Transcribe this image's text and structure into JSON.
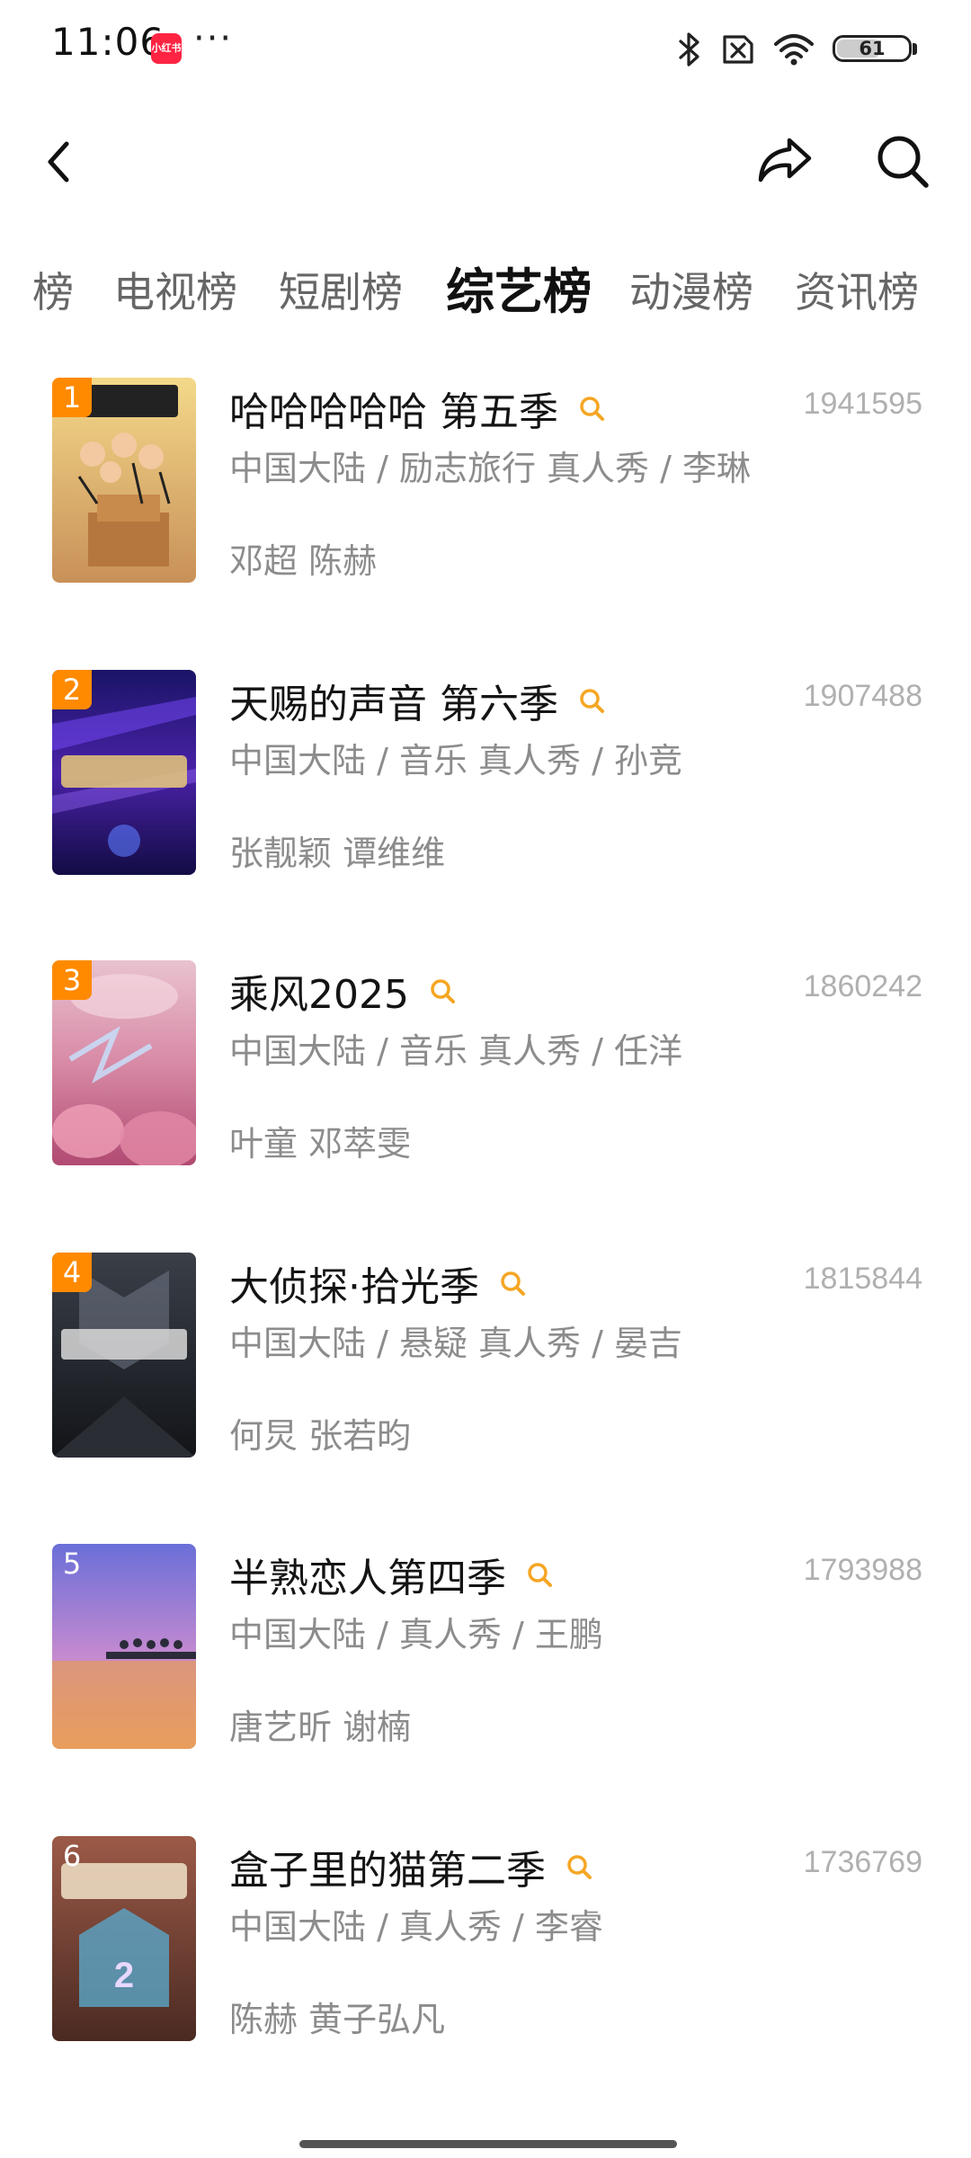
{
  "status": {
    "time": "11:06",
    "app_badge": "小红书",
    "more": "···",
    "battery": "61",
    "battery_level": 0.61
  },
  "nav": {
    "back_icon": "chevron-left-icon",
    "share_icon": "share-icon",
    "search_icon": "search-icon"
  },
  "tabs": [
    {
      "label": "榜"
    },
    {
      "label": "电视榜"
    },
    {
      "label": "短剧榜"
    },
    {
      "label": "综艺榜",
      "active": true
    },
    {
      "label": "动漫榜"
    },
    {
      "label": "资讯榜"
    }
  ],
  "colors": {
    "rank_badge": "#ff8a00",
    "search_accent": "#f5a623"
  },
  "items": [
    {
      "rank": "1",
      "title": "哈哈哈哈哈 第五季",
      "hot": "1941595",
      "meta": "中国大陆 / 励志旅行 真人秀 / 李琳",
      "cast": "邓超 陈赫"
    },
    {
      "rank": "2",
      "title": "天赐的声音 第六季",
      "hot": "1907488",
      "meta": "中国大陆 / 音乐 真人秀 / 孙竞",
      "cast": "张靓颖 谭维维"
    },
    {
      "rank": "3",
      "title": "乘风2025",
      "hot": "1860242",
      "meta": "中国大陆 / 音乐 真人秀 / 任洋",
      "cast": "叶童 邓萃雯"
    },
    {
      "rank": "4",
      "title": "大侦探·拾光季",
      "hot": "1815844",
      "meta": "中国大陆 / 悬疑 真人秀 / 晏吉",
      "cast": "何炅 张若昀"
    },
    {
      "rank": "5",
      "title": "半熟恋人第四季",
      "hot": "1793988",
      "meta": "中国大陆 / 真人秀 / 王鹏",
      "cast": "唐艺昕 谢楠"
    },
    {
      "rank": "6",
      "title": "盒子里的猫第二季",
      "hot": "1736769",
      "meta": "中国大陆 / 真人秀 / 李睿",
      "cast": "陈赫 黄子弘凡"
    }
  ]
}
